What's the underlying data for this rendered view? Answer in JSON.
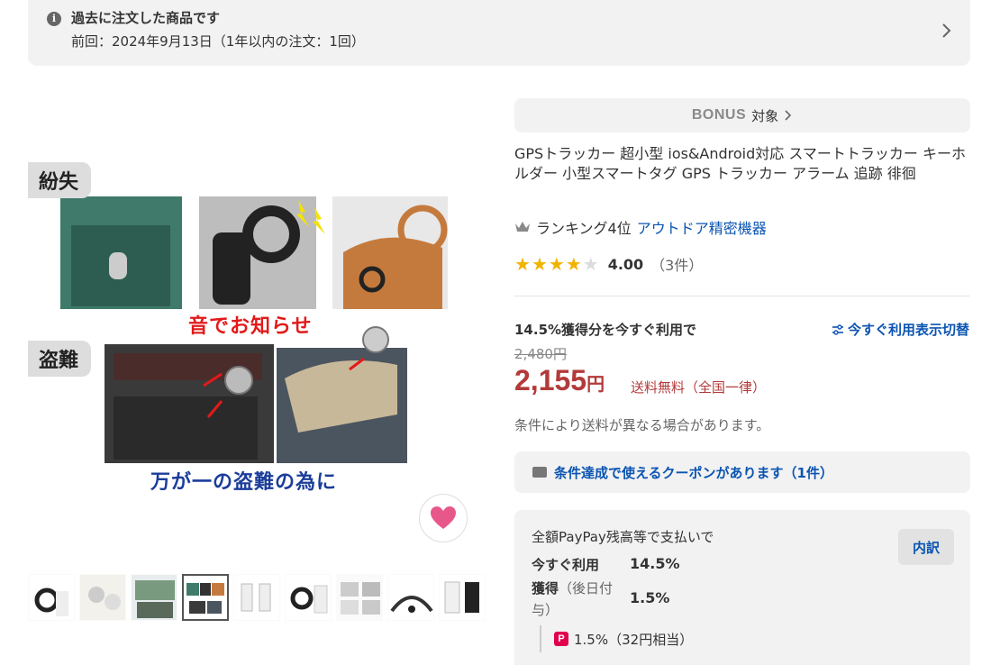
{
  "notice": {
    "title": "過去に注文した商品です",
    "subtitle": "前回：2024年9月13日（1年以内の注文：1回）"
  },
  "gallery": {
    "image_texts": {
      "tag_lost": "紛失",
      "caption_sound": "音でお知らせ",
      "tag_theft": "盗難",
      "caption_theft": "万が一の盗難の為に"
    },
    "thumbnail_count": 9,
    "active_thumbnail": 4
  },
  "bonus": {
    "logo": "BONUS",
    "label": "対象"
  },
  "product": {
    "title": "GPSトラッカー 超小型 ios&Android対応 スマートトラッカー キーホルダー 小型スマートタグ GPS トラッカー アラーム 追跡 徘徊"
  },
  "ranking": {
    "text": "ランキング4位",
    "category": "アウトドア精密機器"
  },
  "rating": {
    "stars": 4,
    "max_stars": 5,
    "score": "4.00",
    "count": "（3件）"
  },
  "pricing": {
    "use_now_label": "14.5%獲得分を今すぐ利用で",
    "toggle_label": "今すぐ利用表示切替",
    "original_price": "2,480円",
    "price_value": "2,155",
    "price_unit": "円",
    "shipping": "送料無料（全国一律）",
    "ship_note": "条件により送料が異なる場合があります。"
  },
  "coupon": {
    "label": "条件達成で使えるクーポンがあります（1件）"
  },
  "paypay": {
    "headline": "全額PayPay残高等で支払いで",
    "breakdown_button": "内訳",
    "use_now_label": "今すぐ利用",
    "use_now_value": "14.5%",
    "earn_label": "獲得",
    "earn_note": "（後日付与）",
    "earn_value": "1.5%",
    "sub_value": "1.5%（32円相当）"
  },
  "colors": {
    "price_red": "#b33a3a",
    "link_blue": "#0b54b1",
    "star_gold": "#f0b400",
    "heart_pink": "#e8578a",
    "paypay_red": "#e0004d"
  }
}
